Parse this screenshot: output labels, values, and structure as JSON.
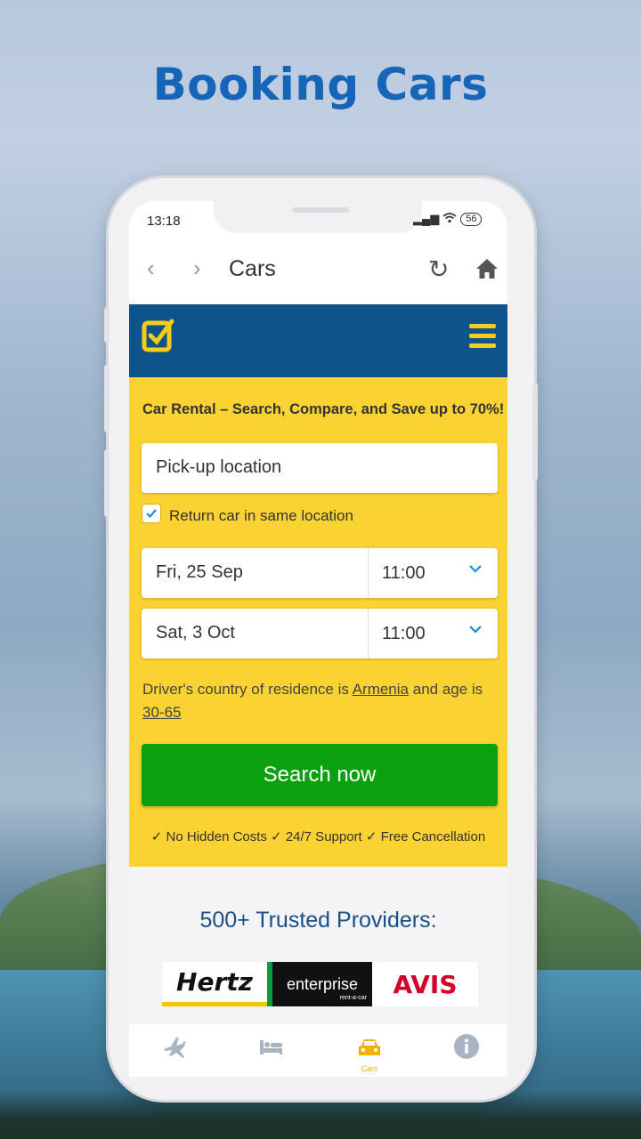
{
  "promo_headline": "Booking Cars",
  "status": {
    "time": "13:18",
    "battery": "56"
  },
  "browser": {
    "title": "Cars"
  },
  "form": {
    "promo": "Car Rental – Search, Compare, and Save up to 70%!",
    "pickup_placeholder": "Pick-up location",
    "return_same_label": "Return car in same location",
    "return_same_checked": true,
    "pickup_date": "Fri, 25 Sep",
    "pickup_time": "11:00",
    "dropoff_date": "Sat, 3 Oct",
    "dropoff_time": "11:00",
    "residence_prefix": "Driver's country of residence is",
    "residence_country": "Armenia",
    "residence_mid": "and age is",
    "residence_age": "30-65",
    "search_button": "Search now",
    "benefits": "✓ No Hidden Costs ✓ 24/7 Support ✓ Free Cancellation"
  },
  "providers": {
    "title": "500+ Trusted Providers:",
    "logos": [
      "Hertz",
      "enterprise",
      "AVIS"
    ],
    "enterprise_sub": "rent-a-car"
  },
  "tabs": {
    "active_label": "Cars",
    "active_color": "#f0b400"
  },
  "colors": {
    "header_blue": "#0e5389",
    "panel_yellow": "#fad232",
    "search_green": "#0aa00e",
    "headline_blue": "#1565b8"
  }
}
